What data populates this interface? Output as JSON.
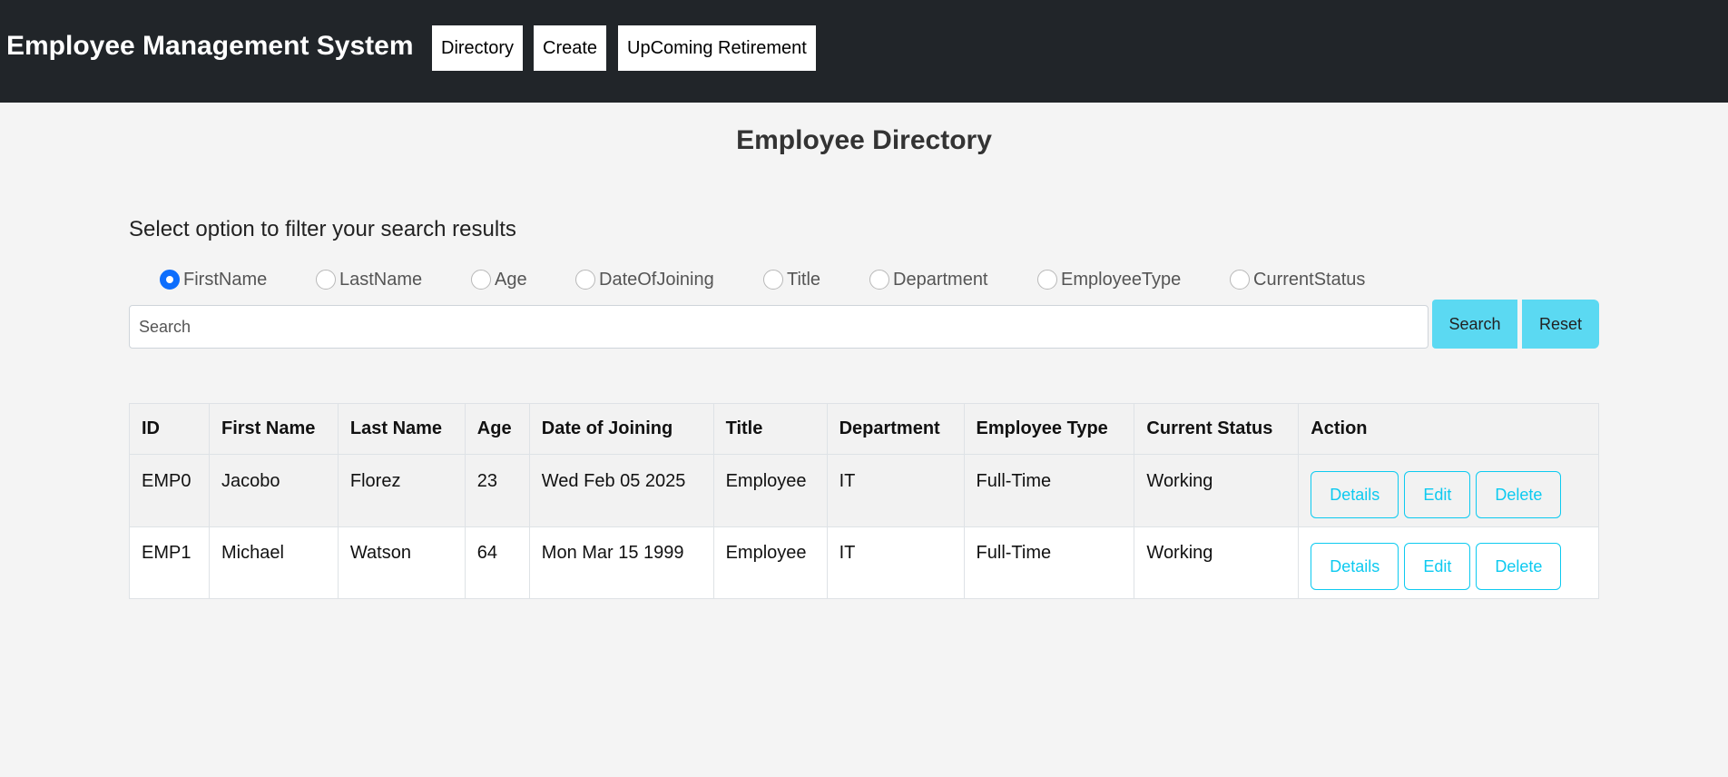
{
  "header": {
    "brand": "Employee Management System",
    "nav": [
      {
        "label": "Directory"
      },
      {
        "label": "Create"
      },
      {
        "label": "UpComing Retirement"
      }
    ]
  },
  "main": {
    "title": "Employee Directory",
    "filter_label": "Select option to filter your search results",
    "radio_options": [
      {
        "label": "FirstName",
        "checked": true
      },
      {
        "label": "LastName",
        "checked": false
      },
      {
        "label": "Age",
        "checked": false
      },
      {
        "label": "DateOfJoining",
        "checked": false
      },
      {
        "label": "Title",
        "checked": false
      },
      {
        "label": "Department",
        "checked": false
      },
      {
        "label": "EmployeeType",
        "checked": false
      },
      {
        "label": "CurrentStatus",
        "checked": false
      }
    ],
    "search": {
      "placeholder": "Search",
      "value": ""
    },
    "search_button": "Search",
    "reset_button": "Reset"
  },
  "table": {
    "columns": [
      "ID",
      "First Name",
      "Last Name",
      "Age",
      "Date of Joining",
      "Title",
      "Department",
      "Employee Type",
      "Current Status",
      "Action"
    ],
    "rows": [
      {
        "id": "EMP0",
        "first_name": "Jacobo",
        "last_name": "Florez",
        "age": "23",
        "doj": "Wed Feb 05 2025",
        "title": "Employee",
        "department": "IT",
        "employee_type": "Full-Time",
        "status": "Working"
      },
      {
        "id": "EMP1",
        "first_name": "Michael",
        "last_name": "Watson",
        "age": "64",
        "doj": "Mon Mar 15 1999",
        "title": "Employee",
        "department": "IT",
        "employee_type": "Full-Time",
        "status": "Working"
      }
    ],
    "actions": {
      "details": "Details",
      "edit": "Edit",
      "delete": "Delete"
    }
  },
  "colors": {
    "header_bg": "#212529",
    "info": "#5bd9f2",
    "outline_info": "#0dcaf0",
    "radio_checked": "#0d6efd"
  }
}
